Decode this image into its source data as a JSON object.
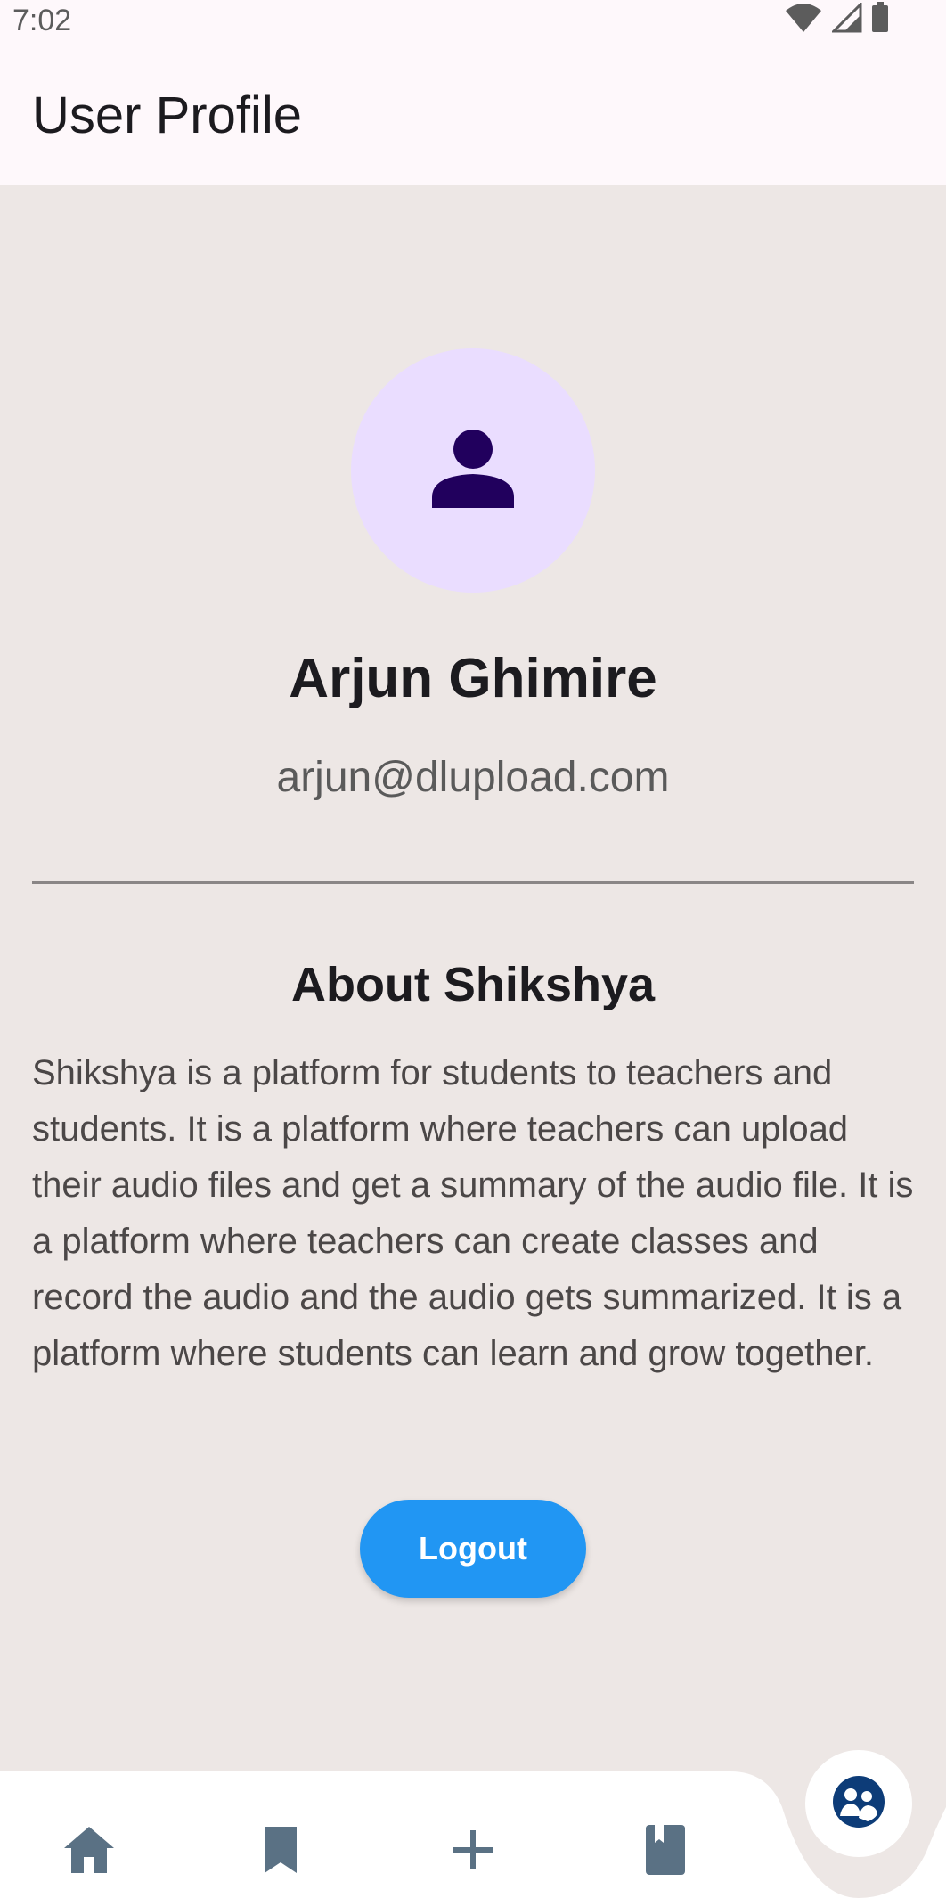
{
  "status_bar": {
    "time": "7:02",
    "icons": [
      "wifi-icon",
      "signal-icon",
      "battery-icon"
    ]
  },
  "app_bar": {
    "title": "User Profile"
  },
  "profile": {
    "avatar_icon": "person-icon",
    "name": "Arjun Ghimire",
    "email": "arjun@dlupload.com"
  },
  "about": {
    "title": "About Shikshya",
    "body": "Shikshya is a platform for students to teachers and students. It is a platform where teachers can upload their audio files and get a summary of the audio file. It is a platform where teachers can create classes and record the audio and the audio gets summarized. It is a platform where students can learn and grow together."
  },
  "actions": {
    "logout_label": "Logout"
  },
  "bottom_nav": {
    "items": [
      "home-icon",
      "bookmark-icon",
      "add-icon",
      "book-icon"
    ],
    "active": "people-icon"
  },
  "colors": {
    "background": "#ede7e5",
    "app_bar": "#fef8fb",
    "avatar_bg": "#eaddff",
    "avatar_icon": "#21005d",
    "accent": "#2196f3",
    "nav_icon": "#5a7184",
    "active_icon": "#0d3c78"
  }
}
